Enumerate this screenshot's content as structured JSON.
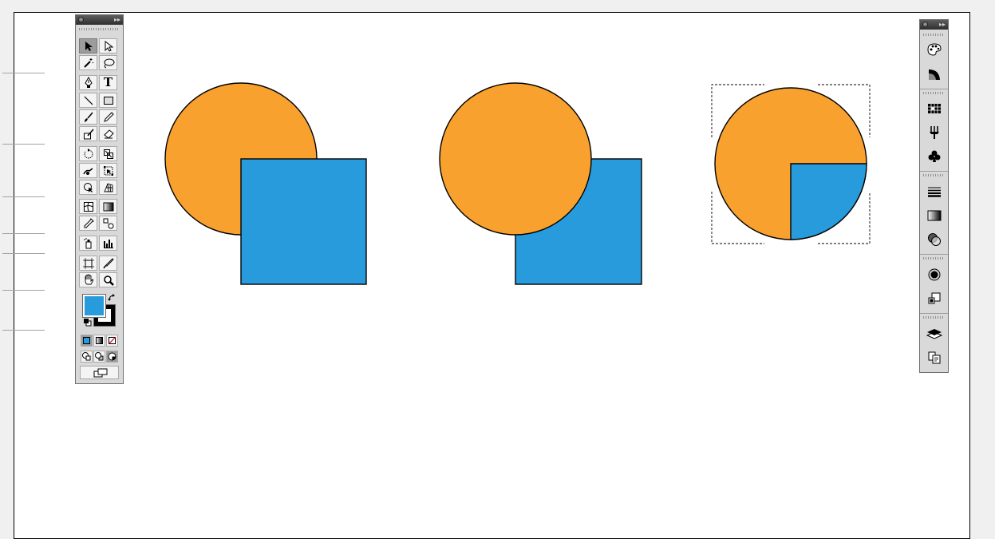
{
  "colors": {
    "shape_orange": "#f9a12f",
    "shape_blue": "#279bdb",
    "outline": "#000000",
    "artboard": "#ffffff",
    "pasteboard": "#f0f0f0",
    "panel_bg": "#d9d9d9"
  },
  "tools_panel": {
    "collapse_glyph": "▸▸",
    "tools": [
      "selection-tool",
      "direct-selection-tool",
      "magic-wand-tool",
      "lasso-tool",
      "pen-tool",
      "type-tool",
      "line-segment-tool",
      "rectangle-tool",
      "paintbrush-tool",
      "pencil-tool",
      "blob-brush-tool",
      "eraser-tool",
      "rotate-tool",
      "scale-tool",
      "warp-tool",
      "free-transform-tool",
      "shape-builder-tool",
      "perspective-grid-tool",
      "mesh-tool",
      "gradient-tool",
      "eyedropper-tool",
      "blend-tool",
      "symbol-sprayer-tool",
      "column-graph-tool",
      "artboard-tool",
      "slice-tool",
      "hand-tool",
      "zoom-tool"
    ],
    "type_tool_glyph": "T",
    "fill_color": "#279bdb",
    "stroke_color": "#000000"
  },
  "dock_panel": {
    "collapse_glyph": "▸▸",
    "panels": [
      "color-panel",
      "color-guide-panel",
      "swatches-panel",
      "brushes-panel",
      "symbols-panel",
      "stroke-panel",
      "gradient-panel",
      "transparency-panel",
      "appearance-panel",
      "graphic-styles-panel",
      "layers-panel",
      "artboards-panel"
    ]
  },
  "artwork": [
    {
      "name": "group-overlap-circle-front",
      "circle_fill": "#f9a12f",
      "square_fill": "#279bdb",
      "stacking": "square-above-circle"
    },
    {
      "name": "group-overlap-square-behind",
      "circle_fill": "#f9a12f",
      "square_fill": "#279bdb",
      "stacking": "circle-above-square"
    },
    {
      "name": "group-intersect-result",
      "circle_fill": "#f9a12f",
      "quadrant_fill": "#279bdb",
      "selected": true
    }
  ]
}
